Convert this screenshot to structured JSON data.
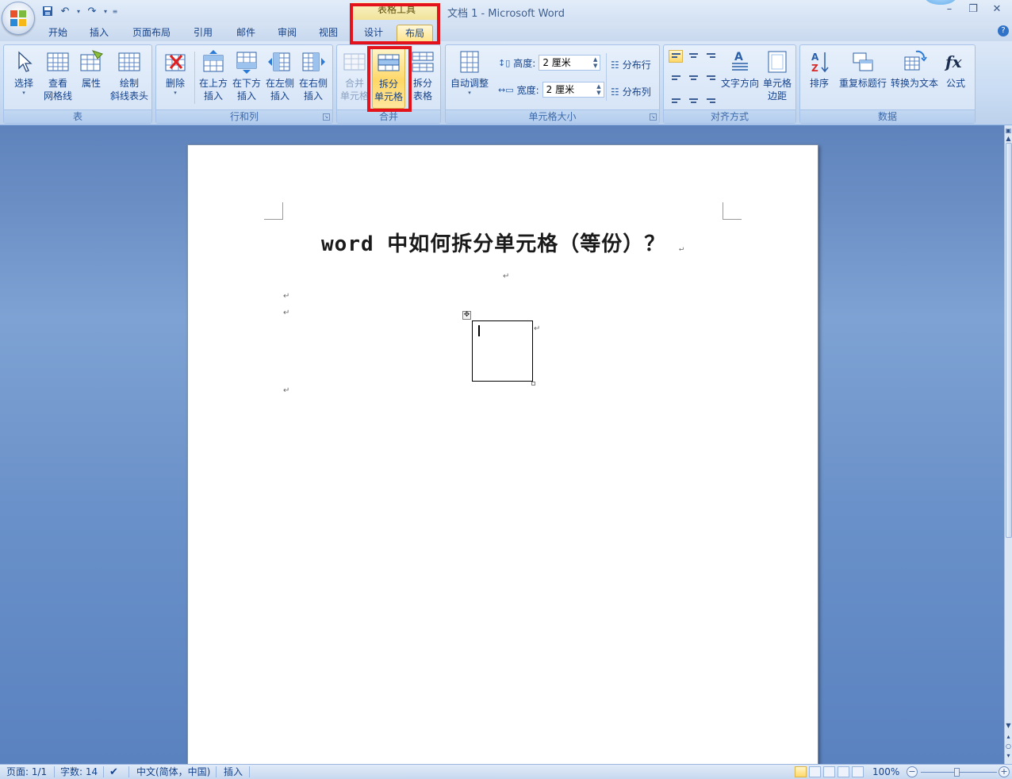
{
  "window": {
    "title": "文档 1 - Microsoft Word",
    "context_tool_label": "表格工具"
  },
  "tabs": [
    "开始",
    "插入",
    "页面布局",
    "引用",
    "邮件",
    "审阅",
    "视图",
    "设计",
    "布局"
  ],
  "active_tab": "布局",
  "ribbon": {
    "groups": {
      "table": "表",
      "rows_cols": "行和列",
      "merge": "合并",
      "cell_size": "单元格大小",
      "alignment": "对齐方式",
      "data": "数据"
    },
    "buttons": {
      "select": "选择",
      "view_grid_1": "查看",
      "view_grid_2": "网格线",
      "properties": "属性",
      "draw_diag_1": "绘制",
      "draw_diag_2": "斜线表头",
      "delete": "删除",
      "insert_above_1": "在上方",
      "insert_below_1": "在下方",
      "insert_left_1": "在左侧",
      "insert_right_1": "在右侧",
      "insert_2": "插入",
      "merge_cells_1": "合并",
      "merge_cells_2": "单元格",
      "split_cells_1": "拆分",
      "split_cells_2": "单元格",
      "split_table_1": "拆分",
      "split_table_2": "表格",
      "autofit": "自动调整",
      "height_label": "高度:",
      "height_value": "2 厘米",
      "width_label": "宽度:",
      "width_value": "2 厘米",
      "distribute_rows": "分布行",
      "distribute_cols": "分布列",
      "text_direction": "文字方向",
      "cell_margins_1": "单元格",
      "cell_margins_2": "边距",
      "sort": "排序",
      "repeat_header": "重复标题行",
      "convert_text": "转换为文本",
      "formula": "公式"
    }
  },
  "document": {
    "heading": "word 中如何拆分单元格（等份）？",
    "para_mark": "↵"
  },
  "status": {
    "page": "页面: 1/1",
    "words": "字数: 14",
    "language": "中文(简体，中国)",
    "mode": "插入",
    "zoom": "100%"
  },
  "colors": {
    "highlight_box": "#e4121b",
    "ribbon_bg": "#c9dcf3",
    "doc_bg": "#6f93c8"
  }
}
